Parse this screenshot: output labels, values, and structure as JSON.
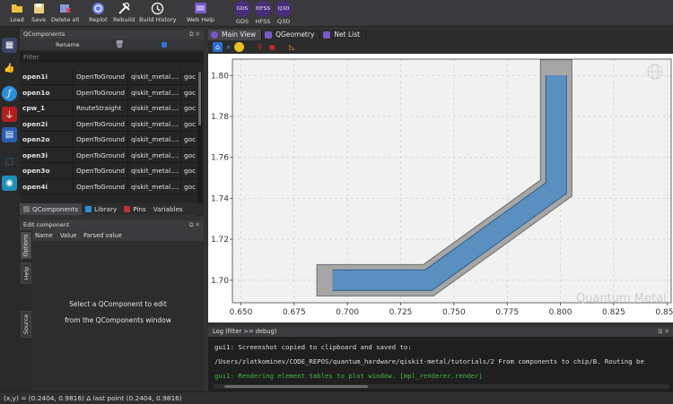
{
  "toolbar": {
    "buttons": [
      {
        "label": "Load",
        "icon": "folder-icon"
      },
      {
        "label": "Save",
        "icon": "save-icon"
      },
      {
        "label": "Delete all",
        "icon": "delete-icon"
      },
      {
        "label": "Replot",
        "icon": "replot-icon"
      },
      {
        "label": "Rebuild",
        "icon": "rebuild-icon"
      },
      {
        "label": "Build History",
        "icon": "history-icon"
      },
      {
        "label": "Web Help",
        "icon": "web-help-icon"
      },
      {
        "label": "GDS",
        "icon_text": "GDS"
      },
      {
        "label": "HFSS",
        "icon_text": "HFSS"
      },
      {
        "label": "Q3D",
        "icon_text": "Q3D"
      }
    ]
  },
  "qcomponents_panel": {
    "title": "QComponents",
    "rename_label": "Rename",
    "filter_placeholder": "Filter",
    "rows": [
      [
        "open1i",
        "OpenToGround",
        "qiskit_metal....",
        "goc"
      ],
      [
        "open1o",
        "OpenToGround",
        "qiskit_metal....",
        "goc"
      ],
      [
        "cpw_1",
        "RouteStraight",
        "qiskit_metal....",
        "goc"
      ],
      [
        "open2i",
        "OpenToGround",
        "qiskit_metal....",
        "goc"
      ],
      [
        "open2o",
        "OpenToGround",
        "qiskit_metal....",
        "goc"
      ],
      [
        "open3i",
        "OpenToGround",
        "qiskit_metal....",
        "goc"
      ],
      [
        "open3o",
        "OpenToGround",
        "qiskit_metal....",
        "goc"
      ],
      [
        "open4i",
        "OpenToGround",
        "qiskit_metal....",
        "goc"
      ]
    ]
  },
  "bottom_tabs": [
    "QComponents",
    "Library",
    "Pins",
    "Variables"
  ],
  "edit_component": {
    "title": "Edit component",
    "columns": [
      "Name",
      "Value",
      "Parsed value"
    ],
    "side_tabs": [
      "Options",
      "Help",
      "Source"
    ],
    "message_line1": "Select a QComponent to edit",
    "message_line2": "from the QComponents window"
  },
  "view_tabs": [
    "Main View",
    "QGeometry",
    "Net List"
  ],
  "plot": {
    "watermark": "Quantum Metal",
    "x_ticks": [
      "0.650",
      "0.675",
      "0.700",
      "0.725",
      "0.750",
      "0.775",
      "0.800",
      "0.825",
      "0.850"
    ],
    "y_ticks": [
      "1.70",
      "1.72",
      "1.74",
      "1.76",
      "1.78",
      "1.80"
    ],
    "colors": {
      "trace": "#5b8fbf",
      "gap": "#a6a6a6",
      "grid": "#d0d0d0"
    }
  },
  "chart_data": {
    "type": "line",
    "title": "",
    "xlabel": "",
    "ylabel": "",
    "xlim": [
      0.646,
      0.852
    ],
    "ylim": [
      1.689,
      1.808
    ],
    "grid": true,
    "series": [
      {
        "x": [
          0.693,
          0.738,
          0.798,
          0.798
        ],
        "y": [
          1.7,
          1.7,
          1.745,
          1.8
        ]
      }
    ]
  },
  "log": {
    "title": "Log  (filter >= debug)",
    "lines": [
      "gui1: Screenshot copied to clipboard and saved to:",
      " /Users/zlatkominev/CODE_REPOS/quantum_hardware/qiskit-metal/tutorials/2 From components to chip/B. Routing be",
      "gui1: Rendering element tables to plot window. [mpl_renderer.render]"
    ],
    "line_colors": [
      "#dcdcdc",
      "#dcdcdc",
      "#3fb83f"
    ]
  },
  "status": {
    "text": "(x,y) = (0.2404, 0.9816)  Δ last point (0.2404, 0.9816)"
  }
}
